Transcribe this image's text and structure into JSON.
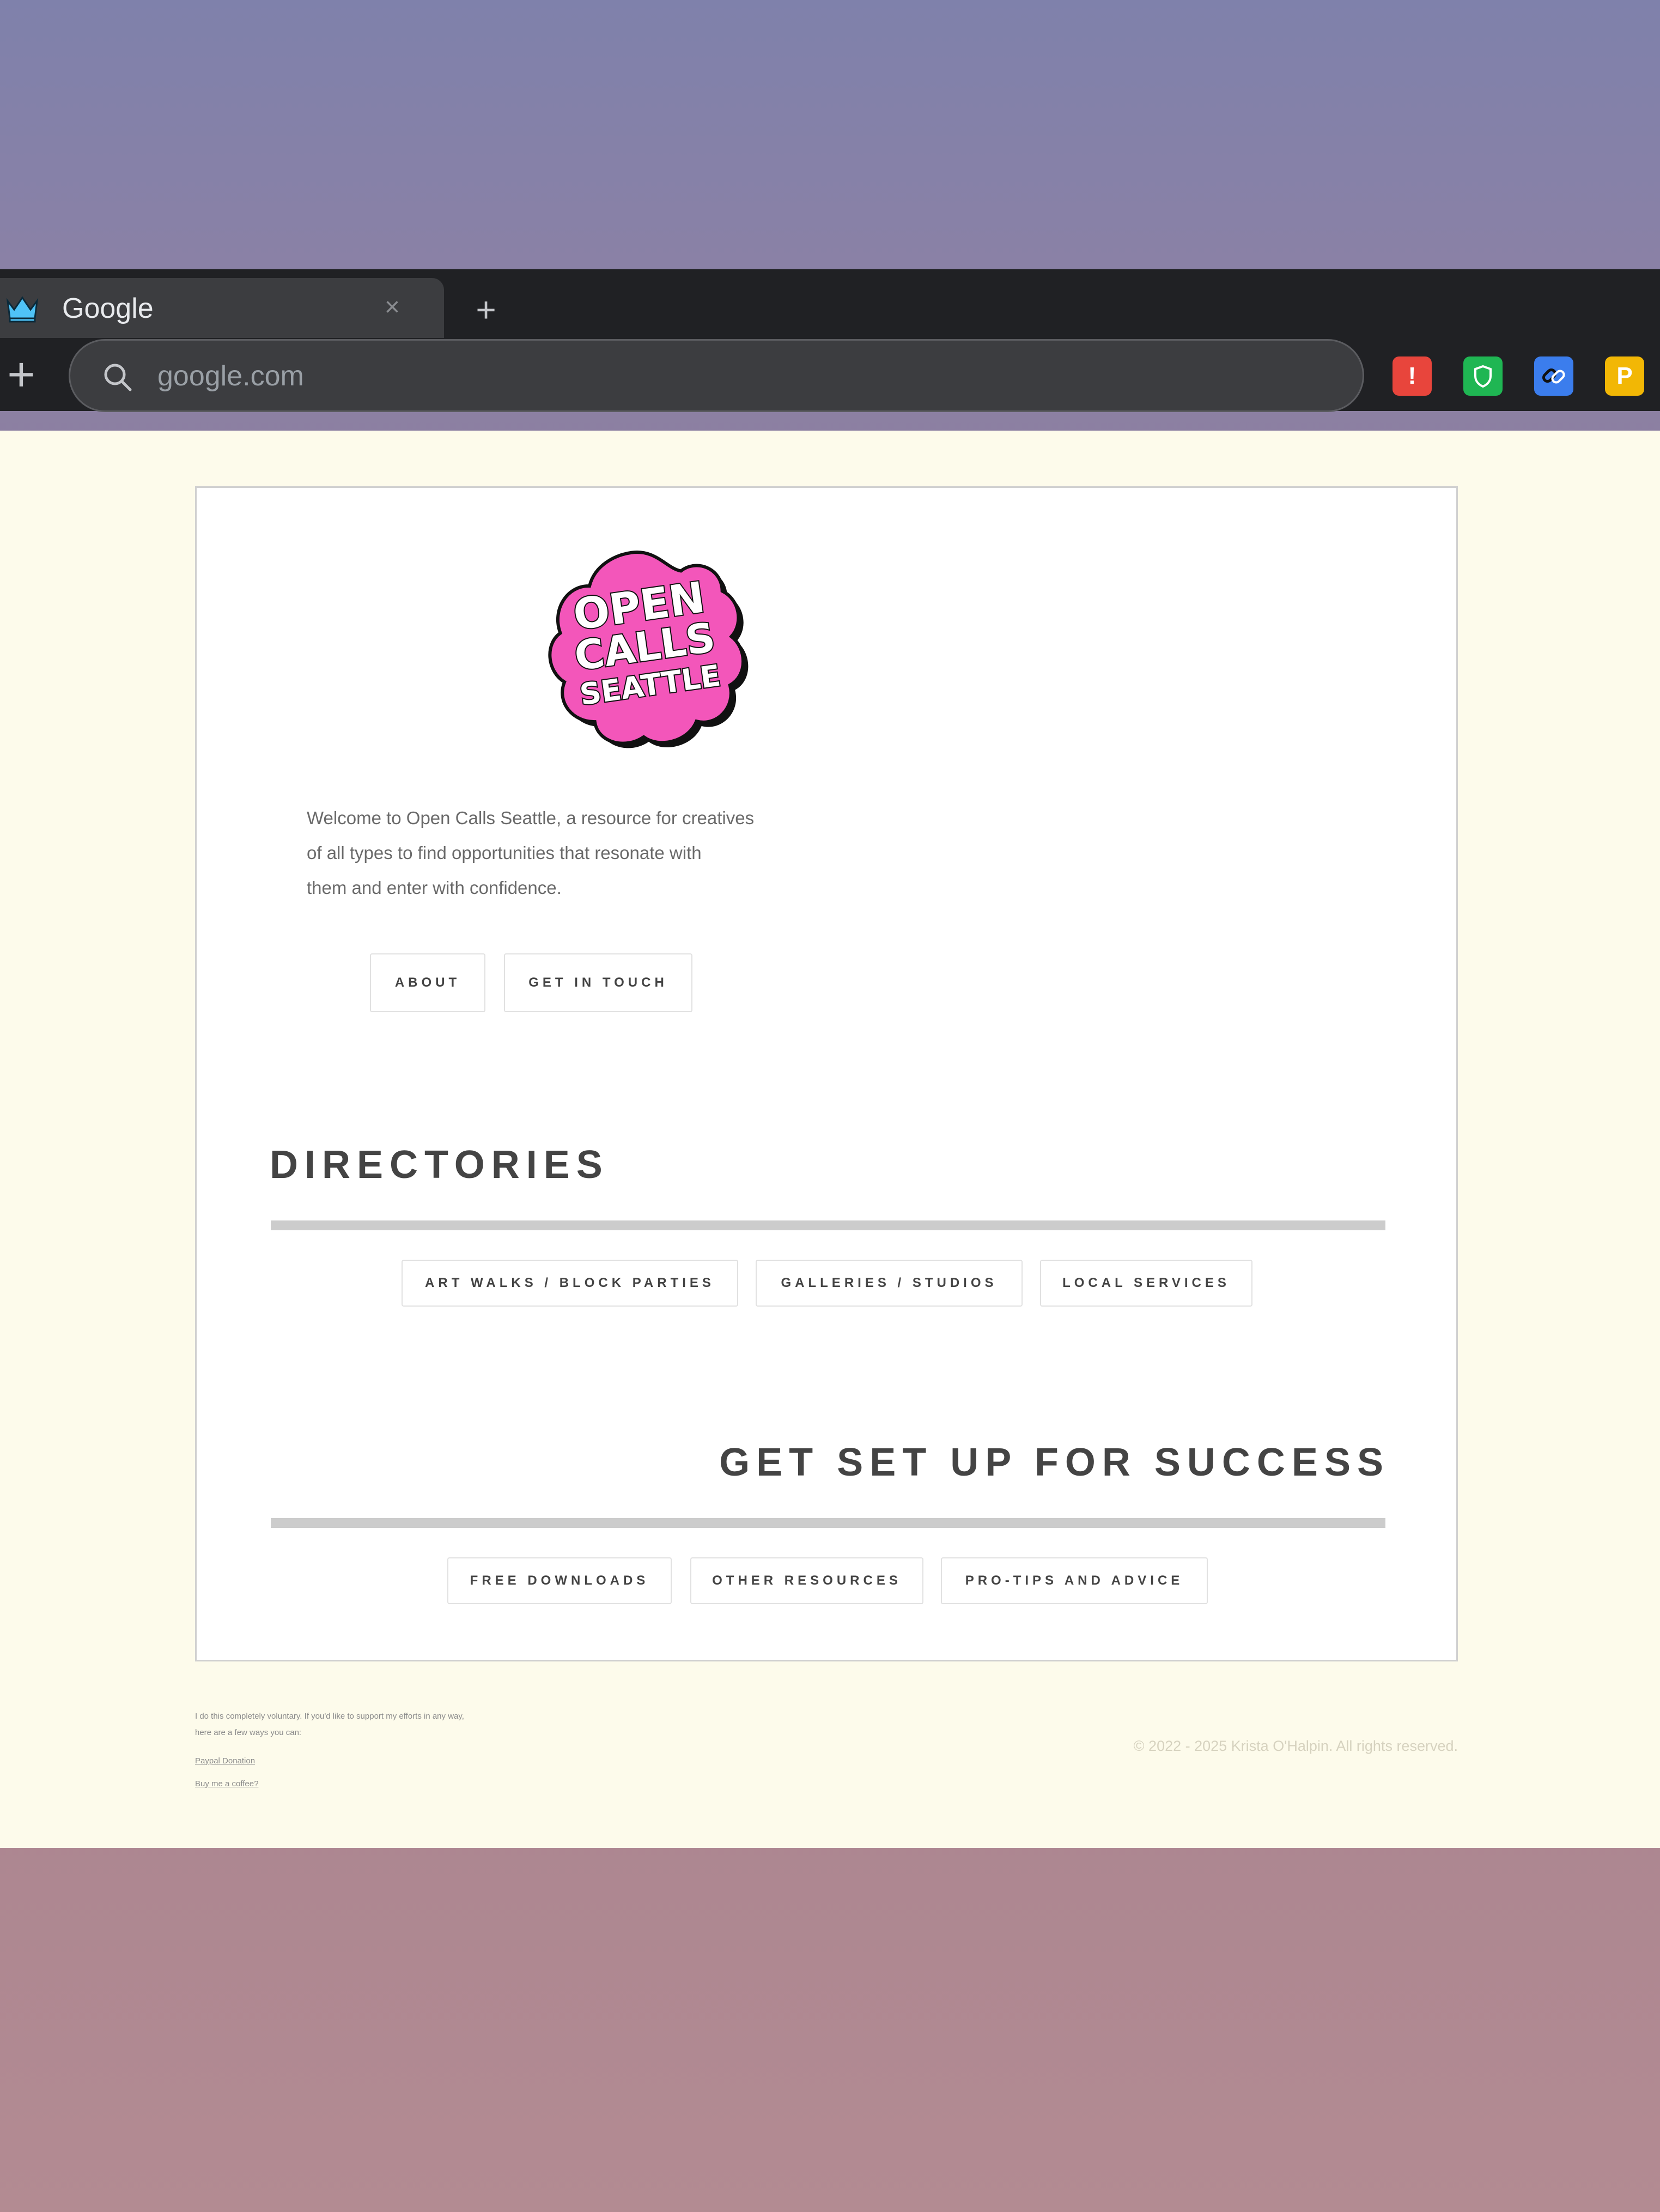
{
  "browser": {
    "tab": {
      "title": "Google",
      "close": "×"
    },
    "new_tab": "+",
    "toolbar_plus": "+",
    "omnibox": {
      "placeholder": "google.com"
    },
    "extensions": [
      {
        "name": "alert-extension",
        "glyph": "!",
        "color": "#e8453c"
      },
      {
        "name": "shield-extension",
        "glyph": "",
        "color": "#1fb653"
      },
      {
        "name": "link-extension",
        "glyph": "",
        "color": "#3b7ded"
      },
      {
        "name": "p-extension",
        "glyph": "P",
        "color": "#f2b705"
      }
    ]
  },
  "site": {
    "logo": {
      "line1": "OPEN",
      "line2": "CALLS",
      "line3": "SEATTLE",
      "color": "#f356ba"
    },
    "intro": {
      "line1": "Welcome to Open Calls Seattle, a resource for creatives",
      "line2": "of all types to find opportunities that resonate with",
      "line3": "them and enter with confidence."
    },
    "nav": {
      "about": "About",
      "contact": "Get in Touch"
    },
    "directories": {
      "title": "DIRECTORIES",
      "buttons": [
        "Art Walks / Block Parties",
        "Galleries / Studios",
        "Local Services"
      ]
    },
    "success": {
      "title": "GET SET UP FOR SUCCESS",
      "buttons": [
        "Free Downloads",
        "Other Resources",
        "Pro-Tips and Advice"
      ]
    },
    "footer": {
      "note_line1": "I do this completely voluntary. If you'd like to support my efforts in any way,",
      "note_line2": "here are a few ways you can:",
      "paypal": "Paypal Donation",
      "coffee": "Buy me a coffee?",
      "copyright": "© 2022 - 2025 Krista O'Halpin. All rights reserved."
    }
  }
}
